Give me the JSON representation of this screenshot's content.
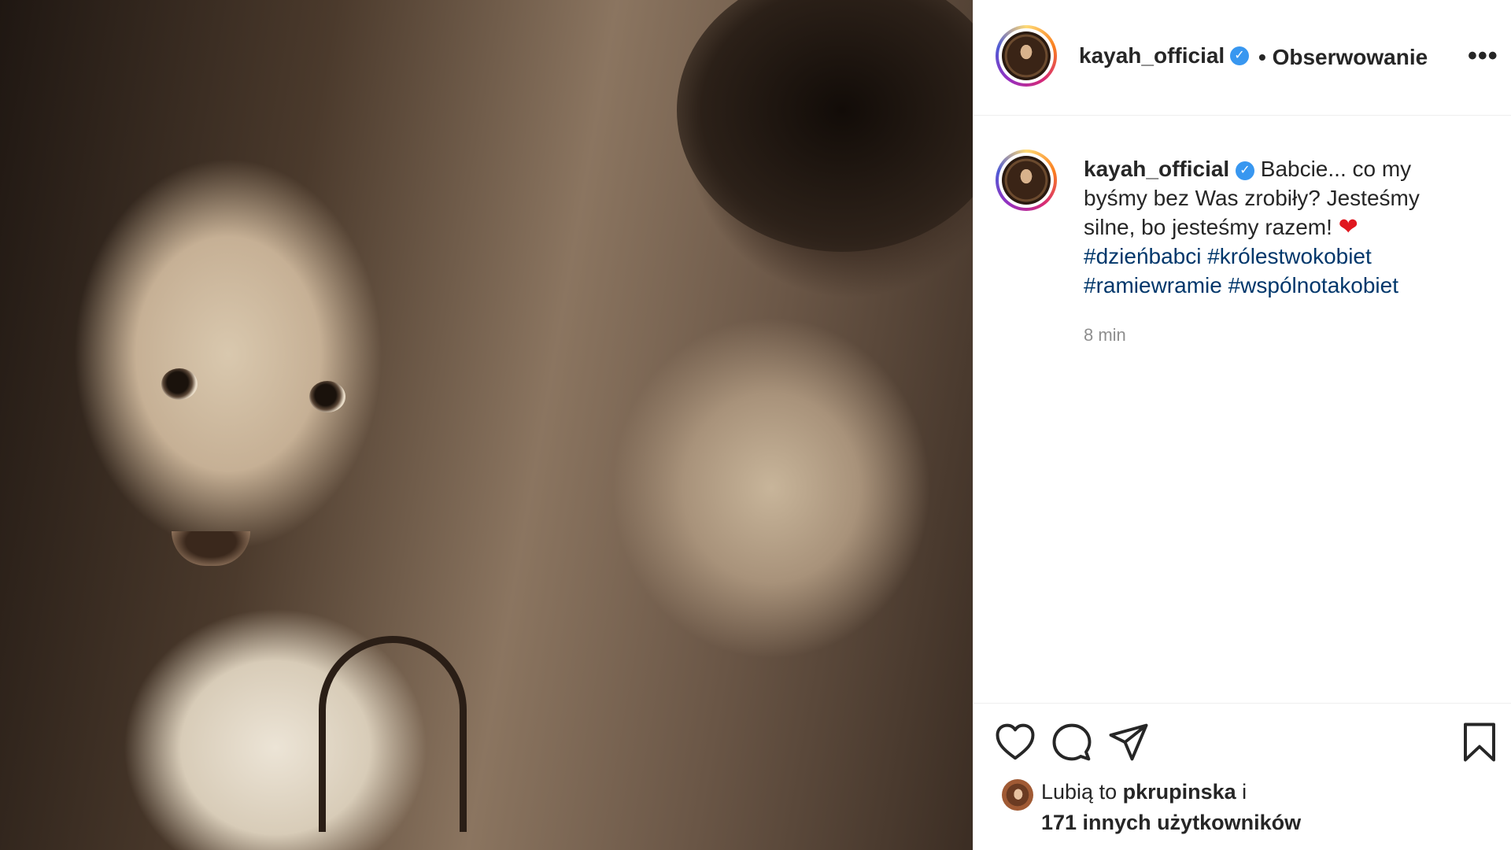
{
  "post": {
    "username": "kayah_official",
    "follow_status": "• Obserwowanie",
    "more_label": "•••",
    "caption_text_1": "Babcie... co my byśmy bez Was zrobiły? Jesteśmy silne, bo jesteśmy razem!",
    "heart_emoji": "❤",
    "hashtags": [
      "#dzieńbabci",
      "#królestwokobiet",
      "#ramiewramie",
      "#wspólnotakobiet"
    ],
    "time": "8 min",
    "likes_prefix": "Lubią to",
    "likes_user": "pkrupinska",
    "likes_and": "i",
    "likes_others": "171 innych użytkowników"
  },
  "icons": {
    "verified": "verified-badge-icon",
    "like": "heart-icon",
    "comment": "comment-icon",
    "share": "share-icon",
    "save": "bookmark-icon"
  },
  "colors": {
    "verified": "#3897f0",
    "hashtag": "#00376b",
    "meta": "#8e8e8e",
    "heart": "#e0171f"
  }
}
